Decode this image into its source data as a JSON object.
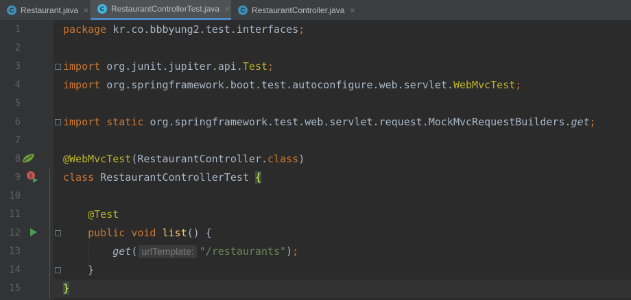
{
  "tabs": [
    {
      "icon": "C",
      "name": "Restaurant.java",
      "active": false
    },
    {
      "icon": "C",
      "name": "RestaurantControllerTest.java",
      "active": true
    },
    {
      "icon": "C",
      "name": "RestaurantController.java",
      "active": false
    }
  ],
  "tab_close_glyph": "×",
  "lines": [
    {
      "num": "1",
      "tokens": [
        {
          "t": "package ",
          "c": "kw"
        },
        {
          "t": "kr.co.bbbyung2.test.interfaces",
          "c": ""
        },
        {
          "t": ";",
          "c": "kw"
        }
      ]
    },
    {
      "num": "2",
      "tokens": []
    },
    {
      "num": "3",
      "tokens": [
        {
          "t": "import ",
          "c": "kw"
        },
        {
          "t": "org.junit.jupiter.api.",
          "c": ""
        },
        {
          "t": "Test",
          "c": "ann"
        },
        {
          "t": ";",
          "c": "kw"
        }
      ]
    },
    {
      "num": "4",
      "tokens": [
        {
          "t": "import ",
          "c": "kw"
        },
        {
          "t": "org.springframework.boot.test.autoconfigure.web.servlet.",
          "c": ""
        },
        {
          "t": "WebMvcTest",
          "c": "ann"
        },
        {
          "t": ";",
          "c": "kw"
        }
      ]
    },
    {
      "num": "5",
      "tokens": []
    },
    {
      "num": "6",
      "tokens": [
        {
          "t": "import static ",
          "c": "kw"
        },
        {
          "t": "org.springframework.test.web.servlet.request.MockMvcRequestBuilders.",
          "c": ""
        },
        {
          "t": "get",
          "c": "ital"
        },
        {
          "t": ";",
          "c": "kw"
        }
      ]
    },
    {
      "num": "7",
      "tokens": []
    },
    {
      "num": "8",
      "tokens": [
        {
          "t": "@WebMvcTest",
          "c": "ann"
        },
        {
          "t": "(RestaurantController.",
          "c": ""
        },
        {
          "t": "class",
          "c": "kw"
        },
        {
          "t": ")",
          "c": ""
        }
      ]
    },
    {
      "num": "9",
      "tokens": [
        {
          "t": "class ",
          "c": "kw"
        },
        {
          "t": "RestaurantControllerTest ",
          "c": ""
        },
        {
          "t": "{",
          "c": "brace-match"
        }
      ]
    },
    {
      "num": "10",
      "tokens": []
    },
    {
      "num": "11",
      "tokens": [
        {
          "t": "    ",
          "c": ""
        },
        {
          "t": "@Test",
          "c": "ann"
        }
      ]
    },
    {
      "num": "12",
      "tokens": [
        {
          "t": "    ",
          "c": ""
        },
        {
          "t": "public void ",
          "c": "kw"
        },
        {
          "t": "list",
          "c": "method"
        },
        {
          "t": "() {",
          "c": ""
        }
      ]
    },
    {
      "num": "13",
      "tokens": [
        {
          "t": "        ",
          "c": ""
        },
        {
          "t": "get",
          "c": "ital"
        },
        {
          "t": "(",
          "c": ""
        },
        {
          "t": "urlTemplate:",
          "c": "hint"
        },
        {
          "t": "\"/restaurants\"",
          "c": "str"
        },
        {
          "t": ")",
          "c": ""
        },
        {
          "t": ";",
          "c": "kw"
        }
      ]
    },
    {
      "num": "14",
      "tokens": [
        {
          "t": "    ",
          "c": ""
        },
        {
          "t": "}",
          "c": ""
        }
      ]
    },
    {
      "num": "15",
      "tokens": [
        {
          "t": "}",
          "c": "brace-match"
        }
      ]
    }
  ],
  "current_line": "15",
  "gutter_icons": {
    "line8": "spring-bean-icon",
    "line9": "run-test-class-icon",
    "line12": "run-test-icon"
  },
  "colors": {
    "keyword": "#cc7832",
    "annotation": "#bbb529",
    "string": "#6a8759",
    "text": "#a9b7c6",
    "accent": "#4a88c7"
  }
}
